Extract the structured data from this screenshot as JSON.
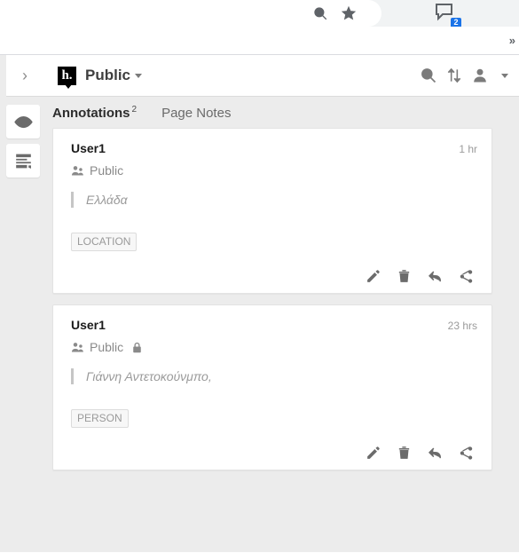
{
  "browser": {
    "omnibox_icons": [
      "zoom-in-icon",
      "bookmark-star-icon"
    ],
    "extension": {
      "name": "hypothesis-extension-icon",
      "badge_count": "2",
      "badge_color": "#1a73e8"
    },
    "overflow_label": "»"
  },
  "sidebar": {
    "collapse_label": "›",
    "logo_text": "h.",
    "group_name": "Public",
    "actions": [
      {
        "name": "search-icon",
        "label": "Search"
      },
      {
        "name": "sort-icon",
        "label": "Sort"
      },
      {
        "name": "account-icon",
        "label": "Account"
      }
    ],
    "rail": [
      {
        "name": "sidebar-item-highlights",
        "icon": "eye-icon",
        "label": "Show highlights"
      },
      {
        "name": "sidebar-item-new-page-note",
        "icon": "note-icon",
        "label": "New page note"
      }
    ]
  },
  "tabs": [
    {
      "label": "Annotations",
      "count": "2",
      "active": true
    },
    {
      "label": "Page Notes",
      "count": "",
      "active": false
    }
  ],
  "annotations": [
    {
      "user": "User1",
      "timestamp": "1 hr",
      "privacy": "Public",
      "locked": false,
      "quote": "Ελλάδα",
      "tags": [
        "LOCATION"
      ],
      "actions": [
        "edit-icon",
        "trash-icon",
        "reply-icon",
        "share-icon"
      ]
    },
    {
      "user": "User1",
      "timestamp": "23 hrs",
      "privacy": "Public",
      "locked": true,
      "quote": "Γιάννη Αντετοκούνμπο,",
      "tags": [
        "PERSON"
      ],
      "actions": [
        "edit-icon",
        "trash-icon",
        "reply-icon",
        "share-icon"
      ]
    }
  ],
  "colors": {
    "accent": "#1a73e8",
    "sidebar_bg": "#ececec",
    "card_bg": "#ffffff",
    "muted_text": "#9a9a9a"
  }
}
